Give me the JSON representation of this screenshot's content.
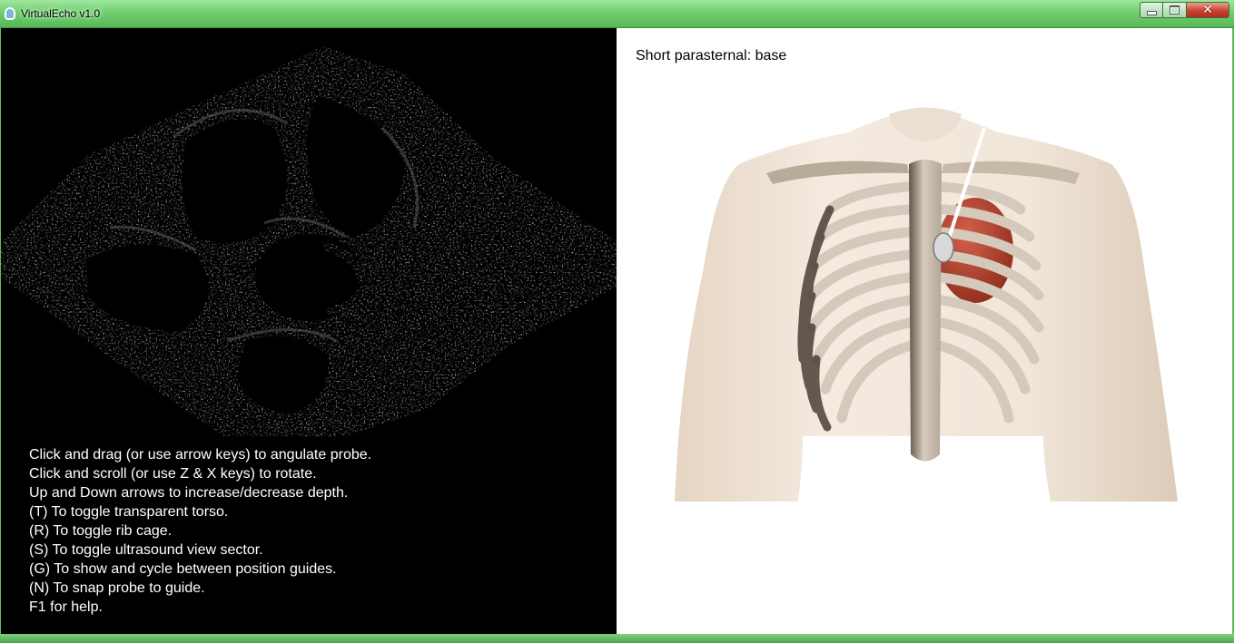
{
  "window": {
    "title": "VirtualEcho v1.0",
    "icon": "app-icon",
    "controls": {
      "minimize": "minimize-icon",
      "maximize": "maximize-icon",
      "close": "close-icon"
    }
  },
  "echo_view": {
    "instructions": [
      "Click and drag (or use arrow keys) to angulate probe.",
      "Click and scroll (or use Z & X keys) to rotate.",
      "Up and Down arrows to increase/decrease depth.",
      "(T) To toggle transparent torso.",
      "(R) To toggle rib cage.",
      "(S) To toggle ultrasound view sector.",
      "(G) To show and cycle between position guides.",
      "(N) To snap probe to guide.",
      "F1 for help."
    ]
  },
  "model_view": {
    "view_name": "Short parasternal: base"
  },
  "colors": {
    "titlebar": "#6fcf6f",
    "echo_background": "#000000",
    "skin": "#efe2d5",
    "bone": "#cfc2b2",
    "heart": "#b5412e",
    "probe": "#d9d9d9"
  }
}
